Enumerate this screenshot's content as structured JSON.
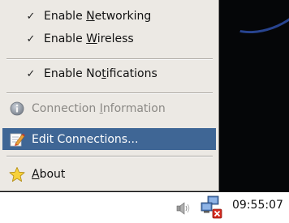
{
  "menu": {
    "enable_networking": {
      "checked": true,
      "before": "Enable ",
      "mnemonic": "N",
      "after": "etworking"
    },
    "enable_wireless": {
      "checked": true,
      "before": "Enable ",
      "mnemonic": "W",
      "after": "ireless"
    },
    "enable_notifications": {
      "checked": true,
      "before": "Enable No",
      "mnemonic": "t",
      "after": "ifications"
    },
    "connection_information": {
      "before": "Connection ",
      "mnemonic": "I",
      "after": "nformation",
      "icon": "info-icon",
      "disabled": true
    },
    "edit_connections": {
      "label": "Edit Connections...",
      "icon": "edit-icon",
      "selected": true
    },
    "about": {
      "mnemonic": "A",
      "after": "bout",
      "icon": "star-icon"
    },
    "check_glyph": "✓"
  },
  "tray": {
    "volume_icon": "speaker-icon",
    "network_icon": "network-disconnected-icon",
    "clock": "09:55:07"
  },
  "colors": {
    "menu_bg": "#ece9e4",
    "selection": "#3f6695",
    "disabled_text": "#8b8985",
    "desktop": "#050608"
  }
}
